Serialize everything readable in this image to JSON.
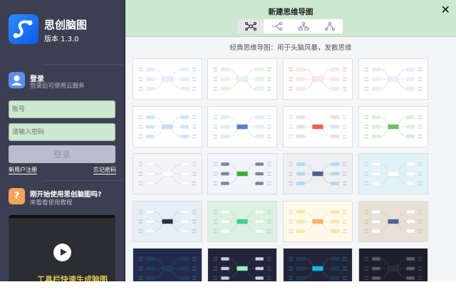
{
  "app": {
    "name": "思创脑图",
    "version": "版本 1.3.0"
  },
  "login": {
    "title": "登录",
    "subtitle": "登录后可使用云服务",
    "account_placeholder": "账号",
    "password_placeholder": "请输入密码",
    "button": "登录",
    "register": "新用户注册",
    "forgot": "忘记密码"
  },
  "help": {
    "icon": "?",
    "title": "刚开始使用思创脑图吗?",
    "subtitle": "来看看使用教程",
    "video_caption": "工具栏快速生成脑图"
  },
  "dialog": {
    "title": "新建思维导图",
    "close": "✕",
    "tabs": [
      "mindmap",
      "logic",
      "org-down",
      "org-tree"
    ],
    "description": "经典思维导图：用于头脑风暴，发散思维"
  },
  "themes": [
    {
      "bg": "#ffffff",
      "center": "#e8eef8",
      "node": "#e8eef8",
      "line": "#d6e2f0"
    },
    {
      "bg": "#ffffff",
      "center": "#e6f3e6",
      "node": "#e6f3e6",
      "line": "#cfe6cf"
    },
    {
      "bg": "#ffffff",
      "center": "#fbe9e7",
      "node": "#fbe9e7",
      "line": "#f3d2cc"
    },
    {
      "bg": "#ffffff",
      "center": "#eceef8",
      "node": "#eceef8",
      "line": "#d9dcee"
    },
    {
      "bg": "#ffffff",
      "center": "#c9dcf8",
      "node": "#d3e3fa",
      "line": "#d6e2f0"
    },
    {
      "bg": "#ffffff",
      "center": "#5b7fc8",
      "node": "#e5ecf7",
      "line": "#d6e2f0"
    },
    {
      "bg": "#ffffff",
      "center": "#f0604c",
      "node": "#e3e3e3",
      "line": "#e6e6e6"
    },
    {
      "bg": "#ffffff",
      "center": "#6abf6a",
      "node": "#dcf0dc",
      "line": "#cfe6cf"
    },
    {
      "bg": "#f4f4f8",
      "center": "#ffffff",
      "node": "#ffffff",
      "line": "#d8d8de"
    },
    {
      "bg": "#f3f3fa",
      "center": "#2fb52a",
      "node": "#7d8496",
      "line": "#d8d8e4"
    },
    {
      "bg": "#eff0f4",
      "center": "#4e5f8f",
      "node": "#a8dff2",
      "line": "#d2d4dc"
    },
    {
      "bg": "#e2f2f7",
      "center": "#ffffff",
      "node": "#ffffff",
      "line": "#c8e2ea"
    },
    {
      "bg": "#e6eef6",
      "center": "#2d323f",
      "node": "#ffffff",
      "line": "#c9d6e3"
    },
    {
      "bg": "#dcf1e2",
      "center": "#3fcf8a",
      "node": "#ffffff",
      "line": "#bfe2c9"
    },
    {
      "bg": "#fefaea",
      "center": "#f4b36a",
      "node": "#fbe7a6",
      "line": "#ece3c6"
    },
    {
      "bg": "#e8e0d6",
      "center": "#4d6497",
      "node": "#ffffff",
      "line": "#d6ccc0"
    },
    {
      "bg": "#222a4e",
      "center": "#1e3a56",
      "node": "#1e3a56",
      "line": "#2f4a66"
    },
    {
      "bg": "#22253a",
      "center": "#8ef0c0",
      "node": "#c9cbe0",
      "line": "#3a3e58"
    },
    {
      "bg": "#222538",
      "center": "#12b8e8",
      "node": "#1c3850",
      "line": "#2a4a66"
    },
    {
      "bg": "#1e1f2c",
      "center": "#2a2b3a",
      "node": "#5a5b66",
      "line": "#3a3b48"
    }
  ]
}
